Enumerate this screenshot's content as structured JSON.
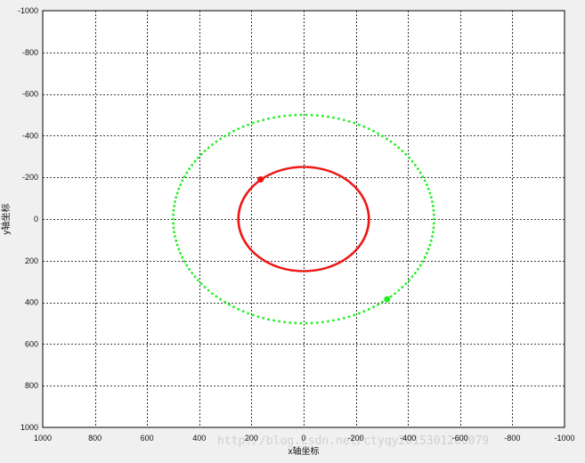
{
  "chart_data": {
    "type": "scatter",
    "title": "",
    "xlabel": "x轴坐标",
    "ylabel": "y轴坐标",
    "xlim": [
      1000,
      -1000
    ],
    "ylim": [
      -1000,
      1000
    ],
    "x_reversed": true,
    "y_reversed": true,
    "xticks": [
      "1000",
      "800",
      "600",
      "400",
      "200",
      "0",
      "-200",
      "-400",
      "-600",
      "-800",
      "-1000"
    ],
    "yticks": [
      "-1000",
      "-800",
      "-600",
      "-400",
      "-200",
      "0",
      "200",
      "400",
      "600",
      "800",
      "1000"
    ],
    "xtick_values": [
      1000,
      800,
      600,
      400,
      200,
      0,
      -200,
      -400,
      -600,
      -800,
      -1000
    ],
    "ytick_values": [
      -1000,
      -800,
      -600,
      -400,
      -200,
      0,
      200,
      400,
      600,
      800,
      1000
    ],
    "grid": true,
    "grid_style": "dashed",
    "series": [
      {
        "shape": "circle",
        "radius": 500,
        "center": [
          0,
          0
        ],
        "points": 150,
        "color": "#22ee22",
        "highlight_point": [
          -320,
          385
        ]
      },
      {
        "shape": "circle",
        "radius": 250,
        "center": [
          0,
          0
        ],
        "points": 180,
        "color": "#ee1111",
        "highlight_point": [
          165,
          -190
        ]
      }
    ]
  },
  "watermark": "http://blog.csdn.net/ctyqy2015301200079"
}
